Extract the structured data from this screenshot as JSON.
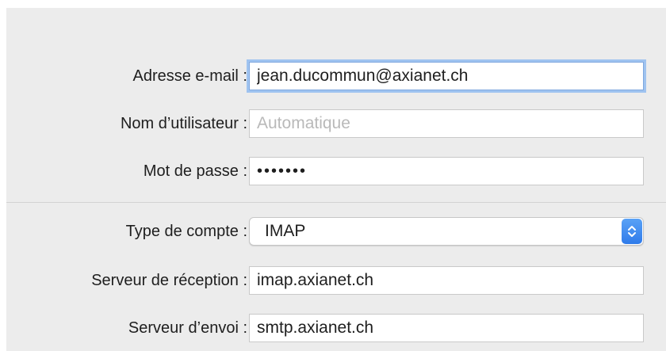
{
  "account": {
    "email_label": "Adresse e-mail :",
    "email_value": "jean.ducommun@axianet.ch",
    "username_label": "Nom d’utilisateur :",
    "username_placeholder": "Automatique",
    "password_label": "Mot de passe :",
    "password_value": "•••••••"
  },
  "server": {
    "account_type_label": "Type de compte :",
    "account_type_value": "IMAP",
    "incoming_label": "Serveur de réception :",
    "incoming_value": "imap.axianet.ch",
    "outgoing_label": "Serveur d’envoi :",
    "outgoing_value": "smtp.axianet.ch"
  },
  "icons": {
    "account_type_stepper": "chevron-up-down-icon"
  },
  "colors": {
    "panel_background": "#ececec",
    "focus_ring": "#9fc3f0",
    "stepper_accent": "#2f7bea",
    "placeholder_text": "#b9b9b9"
  }
}
